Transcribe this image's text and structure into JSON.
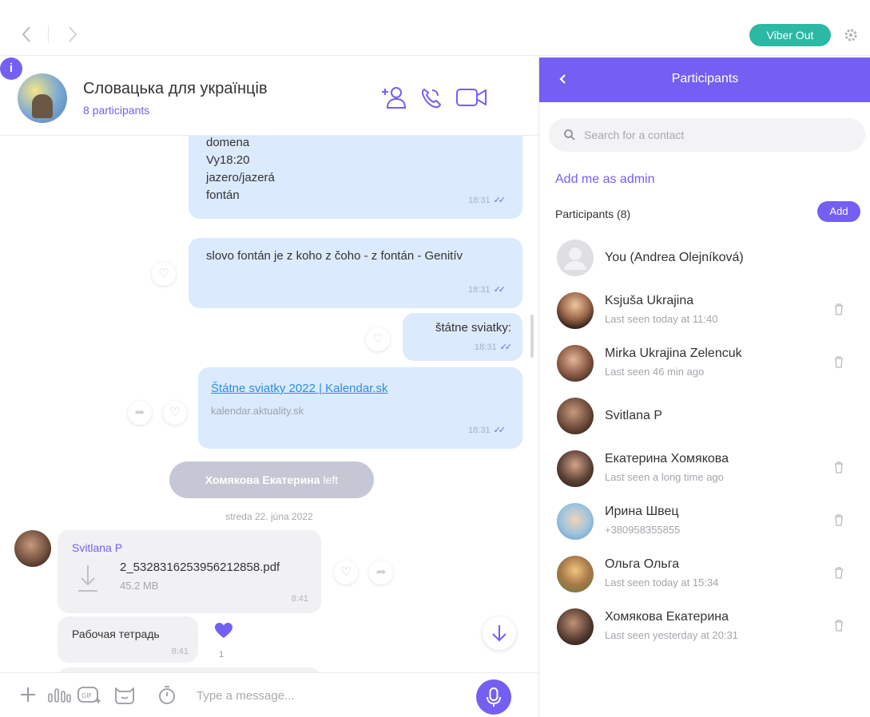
{
  "topbar": {
    "viber_out_label": "Viber Out"
  },
  "chat": {
    "title": "Словацька для українців",
    "participants_count": "8 participants"
  },
  "messages": {
    "m1": {
      "lines": [
        "domena",
        "Vy18:20",
        "jazero/jazerá",
        "fontán"
      ],
      "time": "18:31"
    },
    "m2": {
      "text": "slovo fontán je z koho z čoho - z fontán - Genitív",
      "time": "18:31"
    },
    "m3": {
      "text": "štátne sviatky:",
      "time": "18:31"
    },
    "m4": {
      "link_title": "Štátne sviatky 2022 | Kalendar.sk",
      "domain": "kalendar.aktuality.sk",
      "time": "18:31"
    },
    "system": {
      "name": "Хомякова Екатерина",
      "action": "left"
    },
    "date": "streda 22. júna 2022",
    "in1": {
      "sender": "Svitlana P",
      "file_name": "2_5328316253956212858.pdf",
      "file_size": "45.2 MB",
      "time": "8:41"
    },
    "in2": {
      "text": "Рабочая тетрадь",
      "time": "8:41",
      "reaction_count": "1"
    }
  },
  "composer": {
    "placeholder": "Type a message..."
  },
  "panel": {
    "title": "Participants",
    "search_placeholder": "Search for a contact",
    "add_admin": "Add me as admin",
    "count_label": "Participants (8)",
    "add_button": "Add",
    "participants": [
      {
        "name": "You (Andrea Olejníková)",
        "sub": ""
      },
      {
        "name": "Ksjuša Ukrajina",
        "sub": "Last seen today at 11:40"
      },
      {
        "name": "Mirka Ukrajina Zelencuk",
        "sub": "Last seen 46 min ago"
      },
      {
        "name": "Svitlana P",
        "sub": ""
      },
      {
        "name": "Екатерина Хомякова",
        "sub": "Last seen a long time ago"
      },
      {
        "name": "Ирина Швец",
        "sub": "+380958355855"
      },
      {
        "name": "Ольга Ольга",
        "sub": "Last seen today at 15:34"
      },
      {
        "name": "Хомякова Екатерина",
        "sub": "Last seen yesterday at 20:31"
      }
    ]
  },
  "colors": {
    "accent": "#7360f2",
    "viber_out": "#2bb8a5",
    "outgoing_bubble": "#dbeafd",
    "incoming_bubble": "#f1f1f4"
  }
}
